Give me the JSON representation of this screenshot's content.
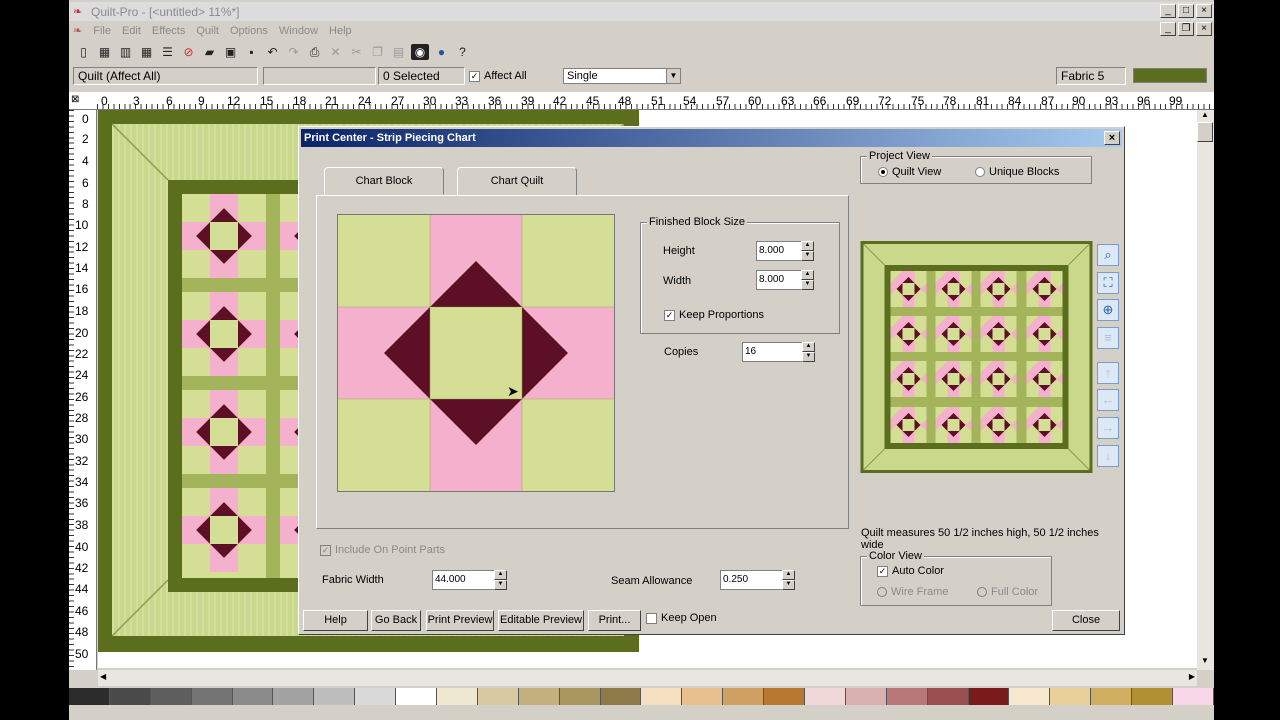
{
  "window": {
    "title": "Quilt-Pro - [<untitled> 11%*]",
    "controls": [
      "_",
      "□",
      "×"
    ]
  },
  "menu": {
    "items": [
      "File",
      "Edit",
      "Effects",
      "Quilt",
      "Options",
      "Window",
      "Help"
    ]
  },
  "toolbar": {
    "icons": [
      "new-icon",
      "grid-icon",
      "grid2-icon",
      "grid3-icon",
      "lines-icon",
      "no-icon",
      "open-icon",
      "lock-icon",
      "save-icon",
      "undo-icon",
      "redo-icon",
      "print-icon",
      "cut-icon",
      "scissors-icon",
      "copy-icon",
      "paste-icon",
      "camera-icon",
      "globe-icon",
      "help-icon"
    ]
  },
  "propbar": {
    "mode": "Quilt (Affect All)",
    "selected": "0 Selected",
    "affect_all": "Affect All",
    "select_value": "Single",
    "fabric": "Fabric 5",
    "fabric_color": "#5a6e1e"
  },
  "ruler": {
    "h": [
      "0",
      "3",
      "6",
      "9",
      "12",
      "15",
      "18",
      "21",
      "24",
      "27",
      "30",
      "33",
      "36",
      "39",
      "42",
      "45",
      "48",
      "51",
      "54",
      "57",
      "60",
      "63",
      "66",
      "69",
      "72",
      "75",
      "78",
      "81",
      "84",
      "87",
      "90",
      "93",
      "96",
      "99"
    ],
    "v": [
      "0",
      "2",
      "4",
      "6",
      "8",
      "10",
      "12",
      "14",
      "16",
      "18",
      "20",
      "22",
      "24",
      "26",
      "28",
      "30",
      "32",
      "34",
      "36",
      "38",
      "40",
      "42",
      "44",
      "46",
      "48",
      "50"
    ]
  },
  "dialog": {
    "title": "Print Center - Strip Piecing Chart",
    "tabs": [
      "Chart Block",
      "Chart Quilt"
    ],
    "finished_block_size": "Finished Block Size",
    "height_label": "Height",
    "height_value": "8.000",
    "width_label": "Width",
    "width_value": "8.000",
    "keep_proportions": "Keep Proportions",
    "copies_label": "Copies",
    "copies_value": "16",
    "include_on_point": "Include On Point Parts",
    "fabric_width_label": "Fabric Width",
    "fabric_width_value": "44.000",
    "seam_allowance_label": "Seam Allowance",
    "seam_allowance_value": "0.250",
    "project_view": "Project View",
    "quilt_view": "Quilt View",
    "unique_blocks": "Unique Blocks",
    "measure_text": "Quilt measures 50 1/2 inches high, 50 1/2 inches wide",
    "color_view": "Color View",
    "auto_color": "Auto Color",
    "wire_frame": "Wire Frame",
    "full_color": "Full Color",
    "buttons": {
      "help": "Help",
      "go_back": "Go Back",
      "print_preview": "Print Preview",
      "editable_preview": "Editable Preview",
      "print": "Print...",
      "keep_open": "Keep Open",
      "close": "Close"
    }
  },
  "colors": {
    "light_green": "#d4df95",
    "dark_green": "#5a6e1e",
    "pink": "#f4b0cc",
    "maroon": "#5c0f25",
    "sash": "#a3b45a"
  },
  "palette": [
    "#2c2c2c",
    "#4b4b4b",
    "#5e5e5e",
    "#747474",
    "#8b8b8b",
    "#a3a3a3",
    "#bdbdbd",
    "#d9d9d9",
    "#ffffff",
    "#eee8d2",
    "#d8caa0",
    "#c4b07c",
    "#a89860",
    "#8c7a48",
    "#f6e0c2",
    "#e8c08e",
    "#cfa061",
    "#b87830",
    "#f0d8d8",
    "#d8b0b0",
    "#b87878",
    "#9a5050",
    "#7a1a1a",
    "#f8e8d0",
    "#e8d09a",
    "#d0b060",
    "#b09030",
    "#f8d8e8"
  ]
}
